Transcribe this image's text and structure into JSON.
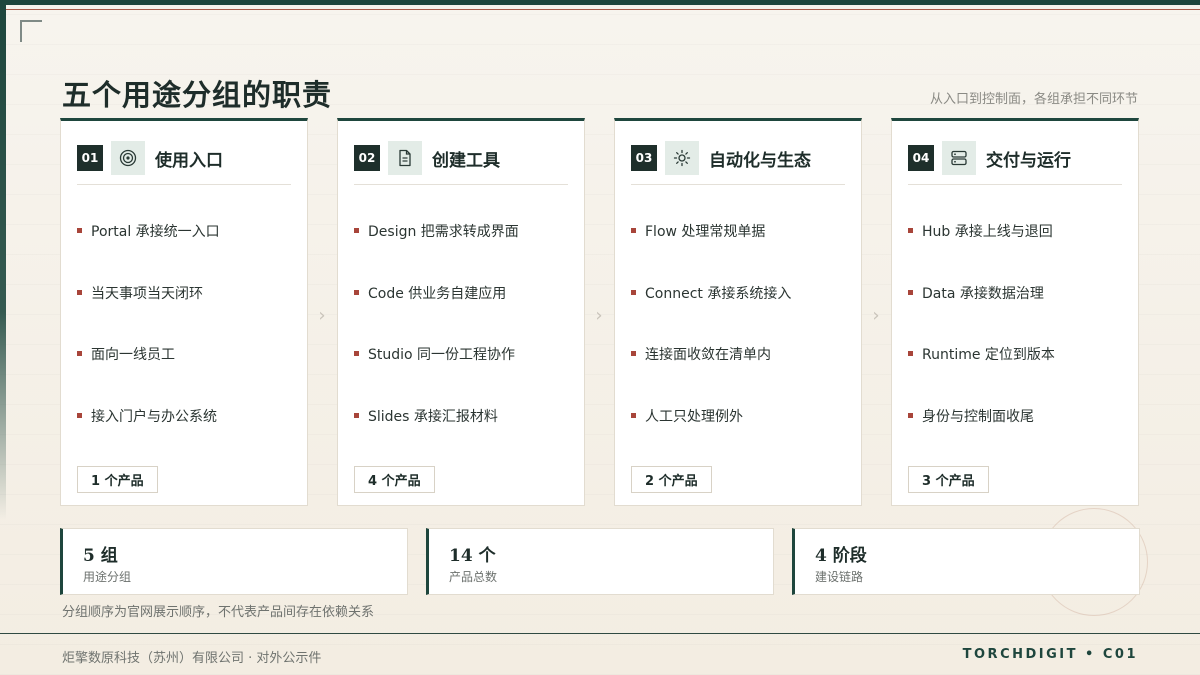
{
  "title": "五个用途分组的职责",
  "subtitle": "从入口到控制面，各组承担不同环节",
  "cards": [
    {
      "num": "01",
      "icon": "target-icon",
      "title": "使用入口",
      "items": [
        "Portal 承接统一入口",
        "当天事项当天闭环",
        "面向一线员工",
        "接入门户与办公系统"
      ],
      "count": "1 个产品"
    },
    {
      "num": "02",
      "icon": "document-icon",
      "title": "创建工具",
      "items": [
        "Design 把需求转成界面",
        "Code 供业务自建应用",
        "Studio 同一份工程协作",
        "Slides 承接汇报材料"
      ],
      "count": "4 个产品"
    },
    {
      "num": "03",
      "icon": "sun-icon",
      "title": "自动化与生态",
      "items": [
        "Flow 处理常规单据",
        "Connect 承接系统接入",
        "连接面收敛在清单内",
        "人工只处理例外"
      ],
      "count": "2 个产品"
    },
    {
      "num": "04",
      "icon": "server-icon",
      "title": "交付与运行",
      "items": [
        "Hub 承接上线与退回",
        "Data 承接数据治理",
        "Runtime 定位到版本",
        "身份与控制面收尾"
      ],
      "count": "3 个产品"
    }
  ],
  "stats": [
    {
      "value": "5 组",
      "label": "用途分组"
    },
    {
      "value": "14 个",
      "label": "产品总数"
    },
    {
      "value": "4 阶段",
      "label": "建设链路"
    }
  ],
  "note": "分组顺序为官网展示顺序，不代表产品间存在依赖关系",
  "footer": {
    "left": "炬擎数原科技（苏州）有限公司 · 对外公示件",
    "right": "TORCHDIGIT • C01"
  },
  "colors": {
    "accent": "#1e463d",
    "bullet": "#a8453a",
    "icon_bg": "#e3ece7"
  }
}
